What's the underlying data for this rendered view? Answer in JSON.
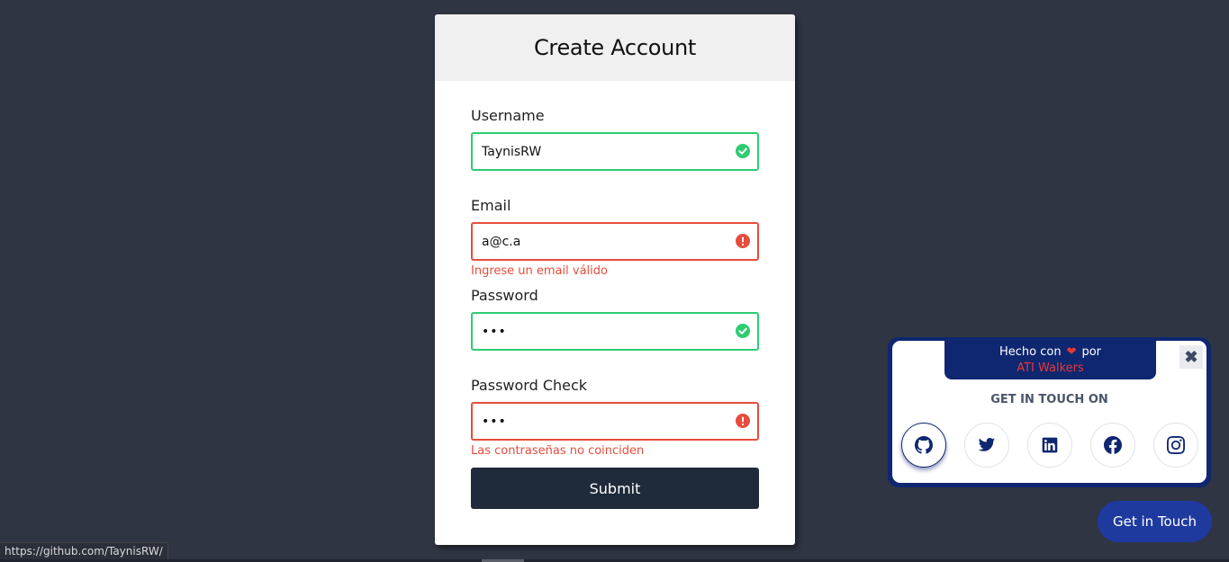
{
  "form": {
    "title": "Create Account",
    "fields": [
      {
        "label": "Username",
        "value": "TaynisRW",
        "status": "valid",
        "error": ""
      },
      {
        "label": "Email",
        "value": "a@c.a",
        "status": "invalid",
        "error": "Ingrese un email válido"
      },
      {
        "label": "Password",
        "value": "•••",
        "status": "valid",
        "error": ""
      },
      {
        "label": "Password Check",
        "value": "•••",
        "status": "invalid",
        "error": "Las contraseñas no coinciden"
      }
    ],
    "submit_label": "Submit"
  },
  "widget": {
    "credit_prefix": "Hecho con",
    "credit_suffix": "por",
    "credit_author": "ATI Walkers",
    "close_label": "✖",
    "heading": "GET IN TOUCH ON",
    "socials": [
      "github-icon",
      "twitter-icon",
      "linkedin-icon",
      "facebook-icon",
      "instagram-icon"
    ]
  },
  "get_in_touch_label": "Get in Touch",
  "status_url": "https://github.com/TaynisRW/",
  "colors": {
    "background": "#2f3543",
    "valid": "#2ecc71",
    "error": "#e74c3c",
    "submit_bg": "#1f2a3a",
    "brand_navy": "#0f2670",
    "get_in_touch_bg": "#1e3a9e"
  }
}
